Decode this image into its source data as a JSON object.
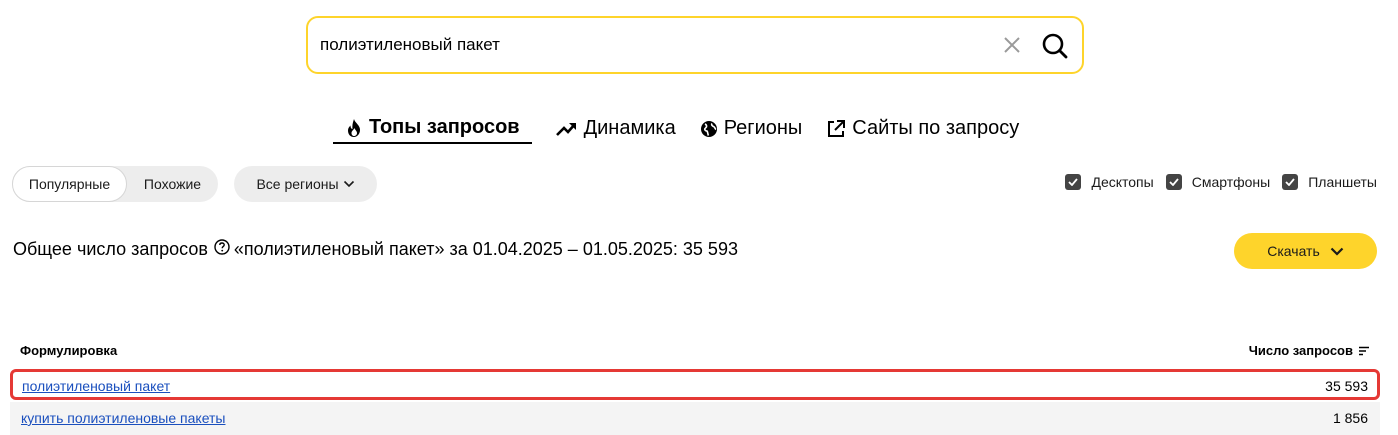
{
  "search": {
    "value": "полиэтиленовый пакет",
    "clear_icon": "close-icon",
    "search_icon": "search-icon"
  },
  "tabs": [
    {
      "label": "Топы запросов",
      "icon": "flame-icon",
      "active": true
    },
    {
      "label": "Динамика",
      "icon": "trend-icon",
      "active": false
    },
    {
      "label": "Регионы",
      "icon": "globe-icon",
      "active": false
    },
    {
      "label": "Сайты по запросу",
      "icon": "external-link-icon",
      "active": false
    }
  ],
  "filters": {
    "popular": "Популярные",
    "similar": "Похожие",
    "regions": "Все регионы"
  },
  "devices": {
    "desktop": "Десктопы",
    "smartphones": "Смартфоны",
    "tablets": "Планшеты"
  },
  "summary": {
    "prefix": "Общее число запросов",
    "text": "«полиэтиленовый пакет» за 01.04.2025 – 01.05.2025: 35 593"
  },
  "download": {
    "label": "Скачать"
  },
  "table": {
    "col_phrase": "Формулировка",
    "col_count": "Число запросов",
    "rows": [
      {
        "phrase": "полиэтиленовый пакет",
        "count": "35 593"
      },
      {
        "phrase": "купить полиэтиленовые пакеты",
        "count": "1 856"
      }
    ]
  },
  "colors": {
    "accent": "#fed42b",
    "link": "#1a4fbe",
    "highlight": "#e53935"
  }
}
